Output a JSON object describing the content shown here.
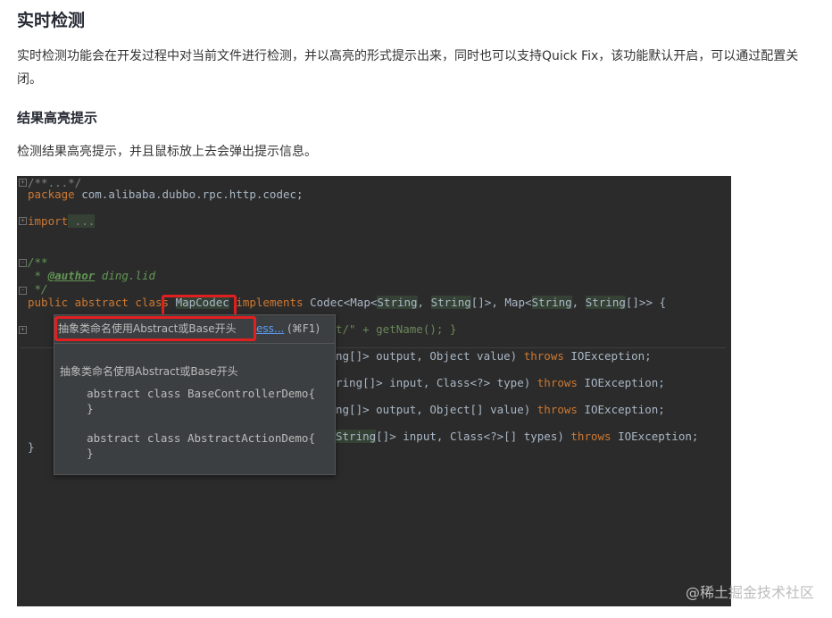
{
  "article": {
    "title": "实时检测",
    "intro": "实时检测功能会在开发过程中对当前文件进行检测，并以高亮的形式提示出来，同时也可以支持Quick Fix，该功能默认开启，可以通过配置关闭。",
    "subtitle": "结果高亮提示",
    "desc": "检测结果高亮提示，并且鼠标放上去会弹出提示信息。"
  },
  "editor": {
    "lines": {
      "l1": "/**...*/",
      "pkg_kw": "package",
      "pkg_name": " com.alibaba.dubbo.rpc.http.codec;",
      "import_kw": "import",
      "import_rest": " ...",
      "doc_open": "/**",
      "doc_star": " * ",
      "doc_tag": "@author",
      "doc_author": " ding.lid",
      "doc_close": " */",
      "cls_public": "public abstract class ",
      "cls_name": "MapCodec",
      "cls_impl": " implements",
      "cls_rest_a": " Codec<Map<",
      "cls_string1": "String",
      "cls_rest_b": ", ",
      "cls_string2": "String",
      "cls_rest_c": "[]>, Map<",
      "cls_string3": "String",
      "cls_rest_d": ", ",
      "cls_string4": "String",
      "cls_rest_e": "[]>> {",
      "l_getname_a": "t/\" + getName(); }",
      "m1_a": "ng[]> output, Object value) ",
      "m1_b": "throws",
      "m1_c": " IOException;",
      "m2_a": "ring[]> input, Class<?> type) ",
      "m2_b": "throws",
      "m2_c": " IOException;",
      "m3_a": "ng[]> output, Object[] value) ",
      "m3_b": "throws",
      "m3_c": " IOException;",
      "m4_a": "String",
      "m4_b": "[]> input, Class<?>[] types) ",
      "m4_c": "throws",
      "m4_d": " IOException;",
      "close": "}"
    },
    "popup": {
      "header": "抽象类命名使用Abstract或Base开头",
      "more_link": "ess...",
      "shortcut": " (⌘F1)",
      "body_title": "抽象类命名使用Abstract或Base开头",
      "example1": "    abstract class BaseControllerDemo{\n    }",
      "example2": "    abstract class AbstractActionDemo{\n    }"
    }
  },
  "watermark": "@稀土掘金技术社区"
}
